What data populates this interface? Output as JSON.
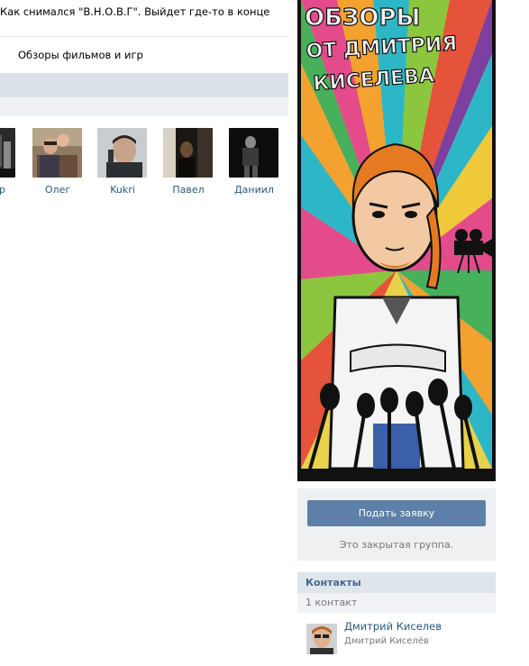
{
  "wall": {
    "status_text": "Как снимался \"В.Н.О.В.Г\". Выйдет где-то в конце"
  },
  "group_link": {
    "label": "Обзоры фильмов и игр"
  },
  "friends": [
    {
      "name": "ор"
    },
    {
      "name": "Олег"
    },
    {
      "name": "Kukri"
    },
    {
      "name": "Павел"
    },
    {
      "name": "Даниил"
    }
  ],
  "poster": {
    "line1": "ОБЗОРЫ",
    "line2": "ОТ ДМИТРИЯ",
    "line3": "КИСЕЛЕВА"
  },
  "join": {
    "button_label": "Подать заявку",
    "note": "Это закрытая группа."
  },
  "contacts": {
    "title": "Контакты",
    "count": "1 контакт",
    "items": [
      {
        "name": "Дмитрий Киселев",
        "role": "Дмитрий Киселёв"
      }
    ]
  },
  "colors": {
    "link": "#2b587a",
    "button": "#5e80a8",
    "section_header": "#dee5eb"
  }
}
